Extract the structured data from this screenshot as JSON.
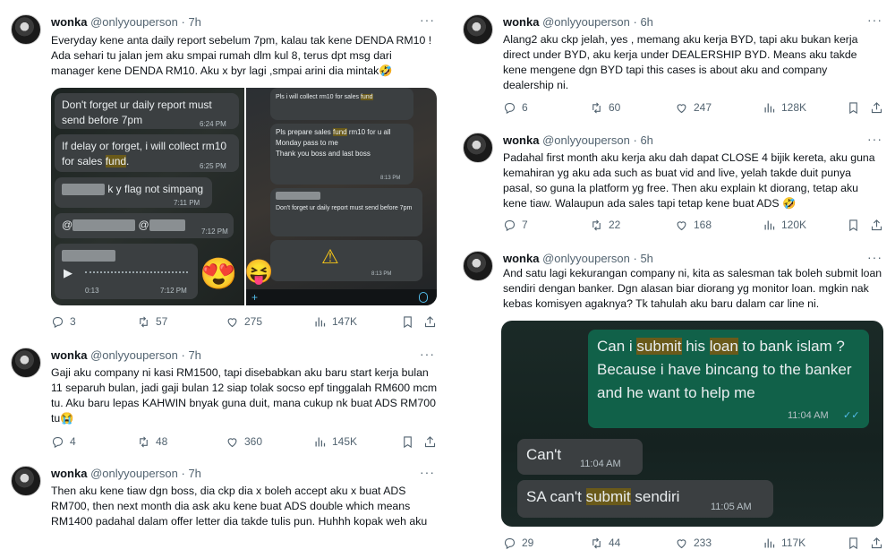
{
  "author": {
    "name": "wonka",
    "handle": "@onlyyouperson",
    "dot": "·"
  },
  "more_label": "···",
  "left": {
    "t1": {
      "time": "7h",
      "text": "Everyday kene anta daily report sebelum 7pm, kalau tak kene DENDA RM10 ! Ada sehari tu jalan jem aku smpai rumah dlm kul 8, terus dpt msg dari manager kene DENDA RM10. Aku x byr lagi ,smpai arini dia mintak🤣",
      "replies": "3",
      "retweets": "57",
      "likes": "275",
      "views": "147K",
      "chat_a": {
        "b1": "Don't forget ur daily report must send before 7pm",
        "b1_time": "6:24 PM",
        "b2_pre": "If delay or forget, i will collect rm10 for sales ",
        "b2_hl": "fund",
        "b2_post": ".",
        "b2_time": "6:25 PM",
        "b3_post": "k y flag not simpang",
        "b3_time": "7:11 PM",
        "b4_pre": "@",
        "b4_mid": "@",
        "b4_time": "7:12 PM",
        "voice_dur": "0:13",
        "voice_time": "7:12 PM",
        "emoji": "😍"
      },
      "chat_b": {
        "top_pre": "Pls i will collect rm10 for sales ",
        "top_hl": "fund",
        "b1_pre": "Pls prepare sales ",
        "b1_hl": "fund",
        "b1_post": " rm10 for u all",
        "b1_l2": "Monday pass to me",
        "b1_l3": "Thank you boss and last boss",
        "b1_time": "8:13 PM",
        "b2": "Don't forget ur daily report must send before 7pm",
        "warn": "⚠",
        "b3_time": "8:13 PM",
        "emoji": "😝"
      }
    },
    "t2": {
      "time": "7h",
      "text": "Gaji aku company ni kasi RM1500, tapi disebabkan aku baru start kerja bulan 11 separuh bulan, jadi gaji bulan 12 siap tolak socso epf tinggalah RM600 mcm tu. Aku baru lepas KAHWIN bnyak guna duit, mana cukup nk buat ADS RM700 tu😭",
      "replies": "4",
      "retweets": "48",
      "likes": "360",
      "views": "145K"
    },
    "t3": {
      "time": "7h",
      "text": "Then aku kene tiaw dgn boss, dia ckp dia x boleh accept aku x buat ADS RM700, then next month dia ask aku kene buat ADS double which means RM1400 padahal dalam offer letter dia takde tulis pun. Huhhh kopak weh aku"
    }
  },
  "right": {
    "t4": {
      "time": "6h",
      "text": "Alang2 aku ckp jelah, yes , memang aku kerja BYD, tapi aku bukan kerja direct under BYD, aku kerja under DEALERSHIP BYD. Means aku takde kene mengene dgn BYD tapi this cases is about aku and company dealership ni.",
      "replies": "6",
      "retweets": "60",
      "likes": "247",
      "views": "128K"
    },
    "t5": {
      "time": "6h",
      "text": "Padahal first month aku kerja aku dah dapat CLOSE 4 bijik kereta, aku guna kemahiran yg aku ada such as buat vid and live, yelah takde duit punya pasal, so guna la platform yg free. Then aku explain kt diorang, tetap aku kene tiaw. Walaupun ada sales tapi tetap kene buat ADS 🤣",
      "replies": "7",
      "retweets": "22",
      "likes": "168",
      "views": "120K"
    },
    "t6": {
      "time": "5h",
      "text": "And satu lagi kekurangan company ni, kita as salesman tak boleh submit loan sendiri dengan banker. Dgn alasan biar diorang yg monitor loan. mgkin nak kebas komisyen agaknya? Tk tahulah aku baru dalam car line ni.",
      "replies": "29",
      "retweets": "44",
      "likes": "233",
      "views": "117K",
      "chat": {
        "m1_a": "Can i ",
        "m1_hl1": "submit",
        "m1_b": " his ",
        "m1_hl2": "loan",
        "m1_c": " to bank islam ? Because i have bincang to the banker and he want to help me",
        "m1_time": "11:04 AM",
        "m1_ticks": "✓✓",
        "m2": "Can't",
        "m2_time": "11:04 AM",
        "m3_a": "SA can't ",
        "m3_hl": "submit",
        "m3_b": " sendiri",
        "m3_time": "11:05 AM"
      }
    }
  }
}
